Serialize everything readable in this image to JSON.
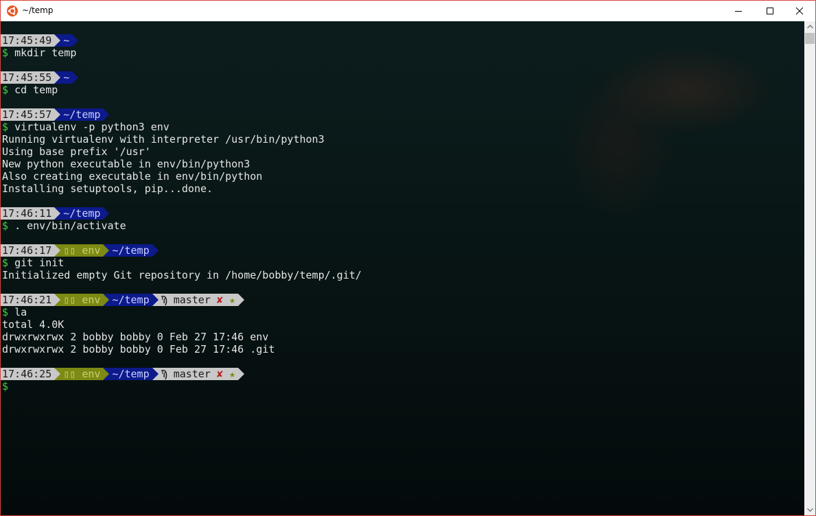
{
  "window": {
    "title": "~/temp",
    "icon": "ubuntu-icon",
    "controls": [
      "minimize-icon",
      "maximize-icon",
      "close-icon"
    ]
  },
  "colors": {
    "frame_border": "#d6433b",
    "time_segment": "#c8c8c8",
    "env_segment": "#7d8a13",
    "dir_segment": "#0c1a8c",
    "prompt_dollar": "#3fd33f",
    "git_dirty": "#b81f1f"
  },
  "terminal": {
    "blocks": [
      {
        "time": "17:45:49",
        "env": null,
        "dir": "~",
        "git": null,
        "command": "mkdir temp",
        "output": []
      },
      {
        "time": "17:45:55",
        "env": null,
        "dir": "~",
        "git": null,
        "command": "cd temp",
        "output": []
      },
      {
        "time": "17:45:57",
        "env": null,
        "dir": "~/temp",
        "git": null,
        "command": "virtualenv -p python3 env",
        "output": [
          "Running virtualenv with interpreter /usr/bin/python3",
          "Using base prefix '/usr'",
          "New python executable in env/bin/python3",
          "Also creating executable in env/bin/python",
          "Installing setuptools, pip...done."
        ]
      },
      {
        "time": "17:46:11",
        "env": null,
        "dir": "~/temp",
        "git": null,
        "command": ". env/bin/activate",
        "output": []
      },
      {
        "time": "17:46:17",
        "env": "▯▯ env",
        "dir": "~/temp",
        "git": null,
        "command": "git init",
        "output": [
          "Initialized empty Git repository in /home/bobby/temp/.git/"
        ]
      },
      {
        "time": "17:46:21",
        "env": "▯▯ env",
        "dir": "~/temp",
        "git": {
          "branch_icon": "Ϡ",
          "branch": "master",
          "dirty": "✘",
          "star": "★"
        },
        "command": "la",
        "output": [
          "total 4.0K",
          "drwxrwxrwx 2 bobby bobby 0 Feb 27 17:46 env",
          "drwxrwxrwx 2 bobby bobby 0 Feb 27 17:46 .git"
        ]
      },
      {
        "time": "17:46:25",
        "env": "▯▯ env",
        "dir": "~/temp",
        "git": {
          "branch_icon": "Ϡ",
          "branch": "master",
          "dirty": "✘",
          "star": "★"
        },
        "command": "",
        "output": []
      }
    ],
    "prompt_symbol": "$"
  }
}
